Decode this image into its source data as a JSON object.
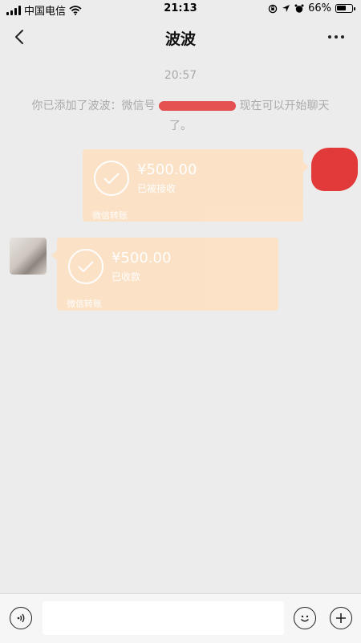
{
  "status_bar": {
    "carrier": "中国电信",
    "time": "21:13",
    "battery_percent": "66%",
    "battery_level": 0.66,
    "icons": [
      "signal-icon",
      "wifi-icon",
      "rotation-lock-icon",
      "location-icon",
      "alarm-icon",
      "battery-icon"
    ]
  },
  "nav": {
    "title": "波波",
    "back_icon": "chevron-left-icon",
    "more_icon": "more-dots-icon"
  },
  "chat": {
    "timestamp": "20:57",
    "system_message": {
      "part1": "你已添加了波波：微信号",
      "part2": "现在可以开始聊天了。"
    },
    "messages": [
      {
        "direction": "outgoing",
        "amount": "¥500.00",
        "status": "已被接收",
        "label": "微信转账"
      },
      {
        "direction": "incoming",
        "amount": "¥500.00",
        "status": "已收款",
        "label": "微信转账"
      }
    ]
  },
  "input_bar": {
    "value": "",
    "icons": [
      "voice-icon",
      "emoji-icon",
      "plus-icon"
    ]
  },
  "colors": {
    "background": "#ececec",
    "transfer_card": "#fce1c4",
    "redaction": "#e23a3a"
  }
}
